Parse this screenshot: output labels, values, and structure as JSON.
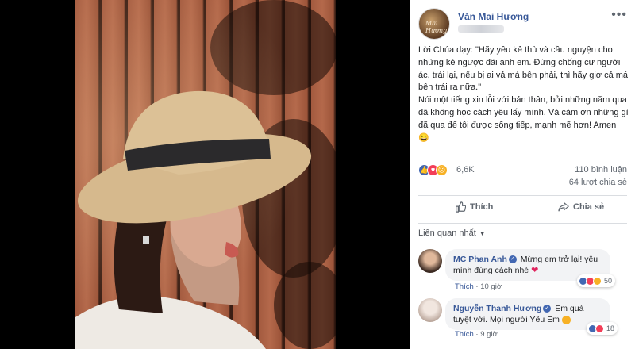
{
  "post": {
    "author": "Văn Mai Hương",
    "avatar_text": "Mai Hương",
    "more": "•••",
    "text": "Lời Chúa dạy: \"Hãy yêu kẻ thù và cầu nguyện cho những kẻ ngược đãi anh em. Đừng chống cự người ác, trái lại, nếu bị ai vả má bên phải, thì hãy giơ cả má bên trái ra nữa.\"\nNói một tiếng xin lỗi với bản thân, bởi những năm qua đã không học cách yêu lấy mình. Và cảm ơn những gì đã qua để tôi được sống tiếp, mạnh mẽ hơn! Amen 😀",
    "reaction_count": "6,6K",
    "comments_count": "110 bình luận",
    "shares_count": "64 lượt chia sẻ"
  },
  "actions": {
    "like": "Thích",
    "share": "Chia sẻ"
  },
  "sort_label": "Liên quan nhất",
  "comments": [
    {
      "name": "MC Phan Anh",
      "text": "Mừng em trở lại! yêu mình đúng cách nhé",
      "reaction_count": "50",
      "like": "Thích",
      "time": "10 giờ"
    },
    {
      "name": "Nguyễn Thanh Hương",
      "text": "Em quá tuyệt vời. Mọi người Yêu Em",
      "reaction_count": "18",
      "like": "Thích",
      "time": "9 giờ"
    }
  ],
  "colors": {
    "link_blue": "#385898",
    "like_blue": "#4267b2",
    "heart_red": "#f33e58",
    "sad_yellow": "#f7b125"
  }
}
